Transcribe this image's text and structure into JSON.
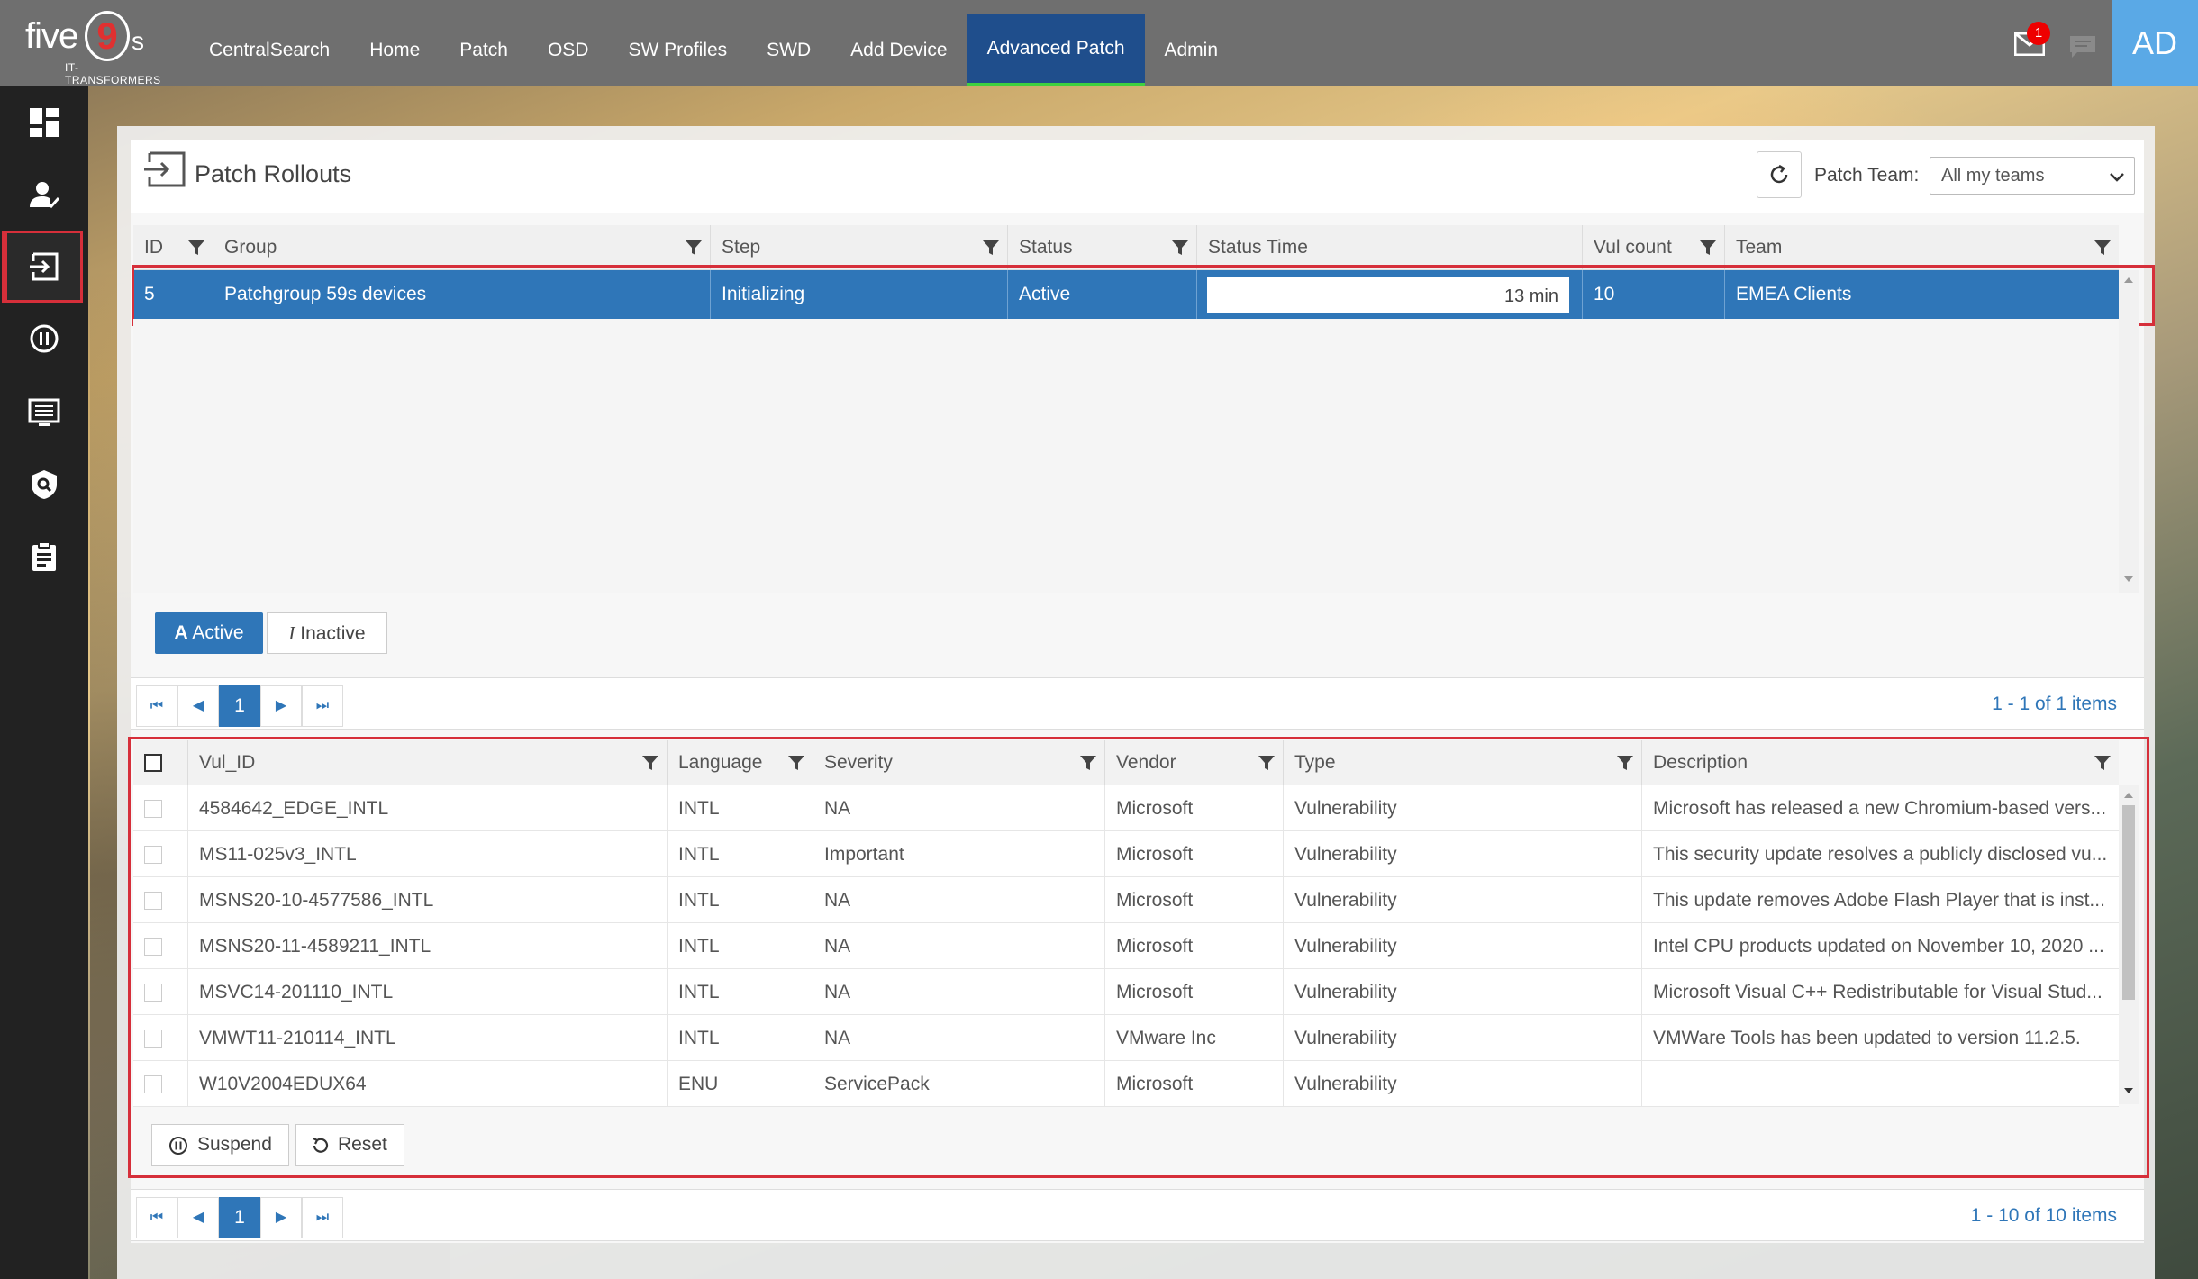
{
  "app": {
    "logo_text": "five",
    "logo_nine": "9",
    "logo_suffix": "s",
    "logo_sub": "IT-TRANSFORMERS"
  },
  "nav": [
    {
      "label": "CentralSearch"
    },
    {
      "label": "Home"
    },
    {
      "label": "Patch"
    },
    {
      "label": "OSD"
    },
    {
      "label": "SW Profiles"
    },
    {
      "label": "SWD"
    },
    {
      "label": "Add Device"
    },
    {
      "label": "Advanced Patch",
      "active": true
    },
    {
      "label": "Admin"
    }
  ],
  "header": {
    "mail_badge": "1",
    "avatar": "AD"
  },
  "sidebar": {
    "items": [
      {
        "icon": "dashboard-icon"
      },
      {
        "icon": "user-check-icon"
      },
      {
        "icon": "rollout-icon",
        "active": true
      },
      {
        "icon": "pause-circle-icon"
      },
      {
        "icon": "list-display-icon"
      },
      {
        "icon": "shield-search-icon"
      },
      {
        "icon": "clipboard-icon"
      }
    ]
  },
  "page": {
    "title": "Patch Rollouts",
    "team_label": "Patch Team:",
    "team_value": "All my teams"
  },
  "rollouts": {
    "columns": [
      "ID",
      "Group",
      "Step",
      "Status",
      "Status Time",
      "Vul count",
      "Team"
    ],
    "rows": [
      {
        "id": "5",
        "group": "Patchgroup 59s devices",
        "step": "Initializing",
        "status": "Active",
        "status_time": "13 min",
        "vul_count": "10",
        "team": "EMEA Clients"
      }
    ]
  },
  "toggle": {
    "active_icon": "A",
    "active_label": "Active",
    "inactive_icon": "I",
    "inactive_label": "Inactive"
  },
  "pager1": {
    "page": "1",
    "info": "1 - 1 of 1 items"
  },
  "vulns": {
    "columns": [
      "Vul_ID",
      "Language",
      "Severity",
      "Vendor",
      "Type",
      "Description"
    ],
    "rows": [
      {
        "vul_id": "4584642_EDGE_INTL",
        "language": "INTL",
        "severity": "NA",
        "vendor": "Microsoft",
        "type": "Vulnerability",
        "description": "Microsoft has released a new Chromium-based vers..."
      },
      {
        "vul_id": "MS11-025v3_INTL",
        "language": "INTL",
        "severity": "Important",
        "vendor": "Microsoft",
        "type": "Vulnerability",
        "description": "This security update resolves a publicly disclosed vu..."
      },
      {
        "vul_id": "MSNS20-10-4577586_INTL",
        "language": "INTL",
        "severity": "NA",
        "vendor": "Microsoft",
        "type": "Vulnerability",
        "description": "This update removes Adobe Flash Player that is inst..."
      },
      {
        "vul_id": "MSNS20-11-4589211_INTL",
        "language": "INTL",
        "severity": "NA",
        "vendor": "Microsoft",
        "type": "Vulnerability",
        "description": "Intel CPU products updated on November 10, 2020 ..."
      },
      {
        "vul_id": "MSVC14-201110_INTL",
        "language": "INTL",
        "severity": "NA",
        "vendor": "Microsoft",
        "type": "Vulnerability",
        "description": "Microsoft Visual C++ Redistributable for Visual Stud..."
      },
      {
        "vul_id": "VMWT11-210114_INTL",
        "language": "INTL",
        "severity": "NA",
        "vendor": "VMware Inc",
        "type": "Vulnerability",
        "description": "VMWare Tools has been updated to version 11.2.5."
      },
      {
        "vul_id": "W10V2004EDUX64",
        "language": "ENU",
        "severity": "ServicePack",
        "vendor": "Microsoft",
        "type": "Vulnerability",
        "description": ""
      }
    ]
  },
  "actions": {
    "suspend": "Suspend",
    "reset": "Reset"
  },
  "pager2": {
    "page": "1",
    "info": "1 - 10 of 10 items"
  },
  "colors": {
    "topbar": "#6f6f6f",
    "nav_active": "#1f4e8c",
    "nav_active_underline": "#3fd03f",
    "selection": "#2f76b8",
    "highlight_frame": "#d62f3a",
    "avatar": "#5aa9e6"
  }
}
